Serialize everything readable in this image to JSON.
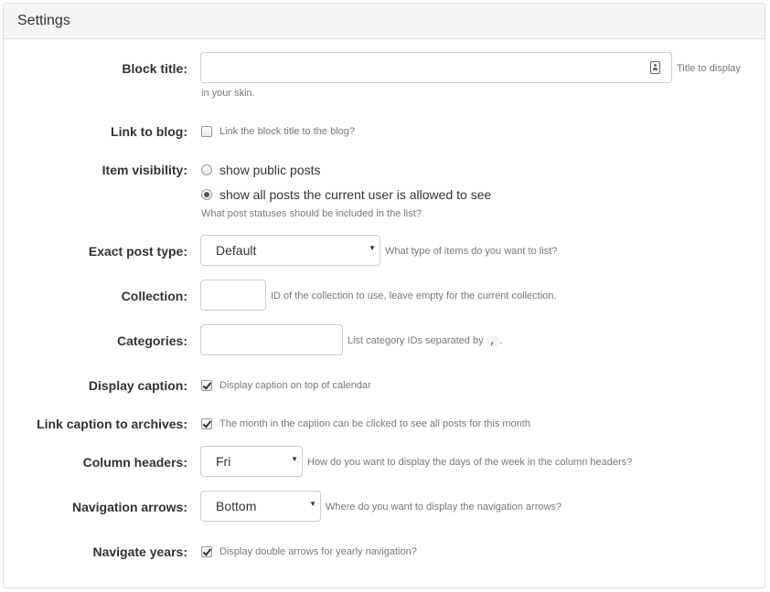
{
  "panel": {
    "title": "Settings"
  },
  "fields": {
    "block_title": {
      "label": "Block title:",
      "value": "",
      "placeholder": "",
      "hint_line1": "Title to display",
      "hint_line2": "in your skin.",
      "icon": "contact-card-icon"
    },
    "link_to_blog": {
      "label": "Link to blog:",
      "checked": false,
      "hint": "Link the block title to the blog?"
    },
    "item_visibility": {
      "label": "Item visibility:",
      "options": [
        {
          "label": "show public posts",
          "selected": false
        },
        {
          "label": "show all posts the current user is allowed to see",
          "selected": true
        }
      ],
      "hint": "What post statuses should be included in the list?"
    },
    "exact_post_type": {
      "label": "Exact post type:",
      "value": "Default",
      "hint": "What type of items do you want to list?"
    },
    "collection": {
      "label": "Collection:",
      "value": "",
      "hint": "ID of the collection to use, leave empty for the current collection."
    },
    "categories": {
      "label": "Categories:",
      "value": "",
      "hint_before": "List category IDs separated by",
      "separator": ",",
      "hint_after": "."
    },
    "display_caption": {
      "label": "Display caption:",
      "checked": true,
      "hint": "Display caption on top of calendar"
    },
    "link_caption": {
      "label": "Link caption to archives:",
      "checked": true,
      "hint": "The month in the caption can be clicked to see all posts for this month"
    },
    "column_headers": {
      "label": "Column headers:",
      "value": "Fri",
      "hint": "How do you want to display the days of the week in the column headers?"
    },
    "navigation_arrows": {
      "label": "Navigation arrows:",
      "value": "Bottom",
      "hint": "Where do you want to display the navigation arrows?"
    },
    "navigate_years": {
      "label": "Navigate years:",
      "checked": true,
      "hint": "Display double arrows for yearly navigation?"
    }
  },
  "colors": {
    "label_text": "#333333",
    "hint_text": "#777777",
    "border": "#cccccc",
    "heading_bg": "#f5f5f5"
  }
}
